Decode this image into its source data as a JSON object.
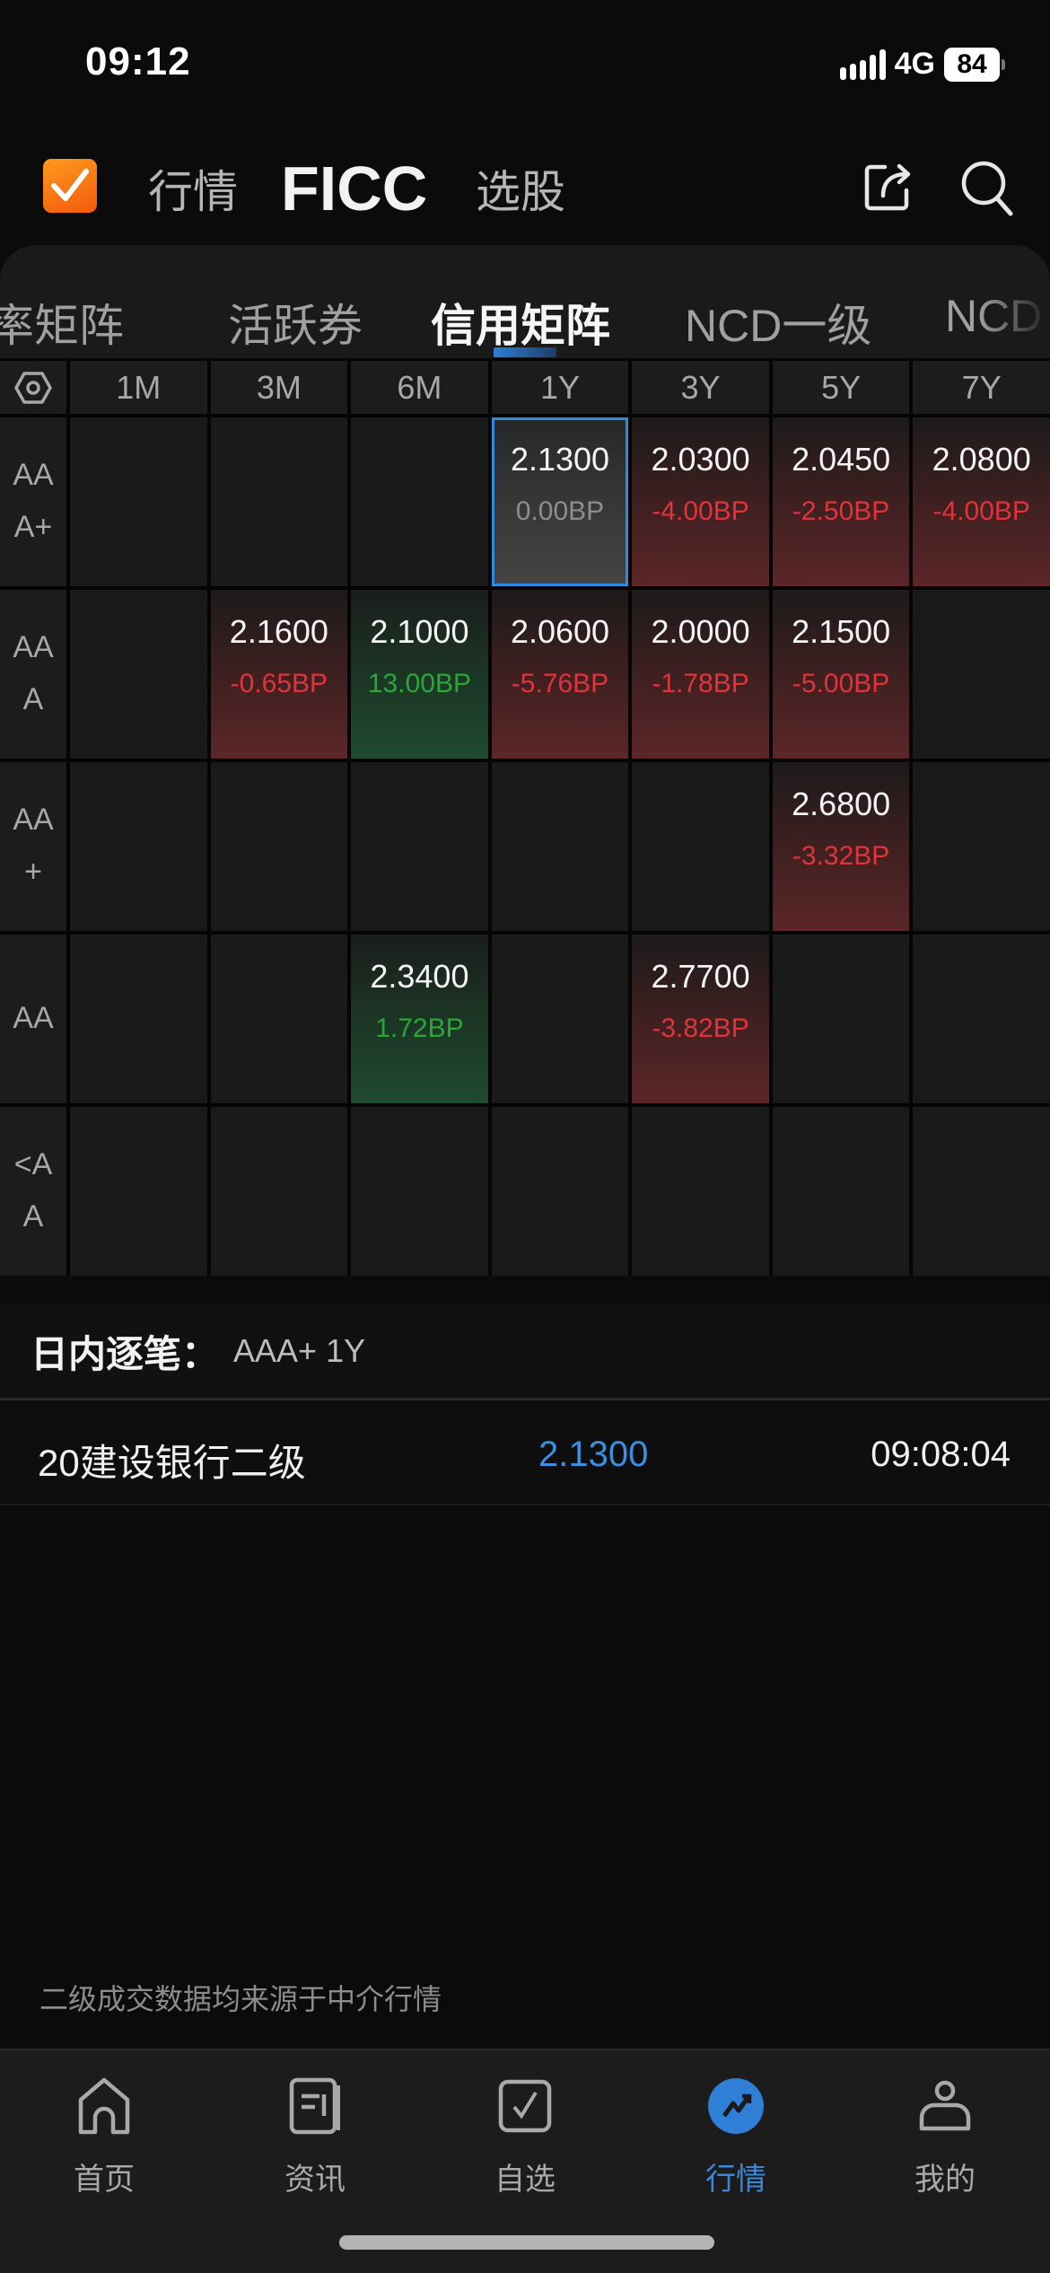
{
  "status_bar": {
    "time": "09:12",
    "network": "4G",
    "battery": "84",
    "icons": [
      "signal-icon",
      "battery-icon"
    ]
  },
  "app_header": {
    "logo": "app-logo-checkmark",
    "nav": [
      "行情",
      "FICC",
      "选股"
    ],
    "active_nav": "FICC",
    "actions": [
      "share-icon",
      "search-icon"
    ]
  },
  "sub_tabs": {
    "items": [
      "利率矩阵",
      "活跃券",
      "信用矩阵",
      "NCD一级",
      "NCD"
    ],
    "visible_labels": [
      "率矩阵",
      "活跃券",
      "信用矩阵",
      "NCD一级",
      "NCD"
    ],
    "active": "信用矩阵"
  },
  "matrix": {
    "settings_icon": "settings-hex-icon",
    "columns": [
      "1M",
      "3M",
      "6M",
      "1Y",
      "3Y",
      "5Y",
      "7Y"
    ],
    "rows": [
      {
        "label": "AAA+",
        "label_lines": [
          "AA",
          "A+"
        ],
        "cells": [
          null,
          null,
          null,
          {
            "rate": "2.1300",
            "change": "0.00BP",
            "trend": "flat",
            "selected": true
          },
          {
            "rate": "2.0300",
            "change": "-4.00BP",
            "trend": "down"
          },
          {
            "rate": "2.0450",
            "change": "-2.50BP",
            "trend": "down"
          },
          {
            "rate": "2.0800",
            "change": "-4.00BP",
            "trend": "down"
          }
        ]
      },
      {
        "label": "AAA",
        "label_lines": [
          "AA",
          "A"
        ],
        "cells": [
          null,
          {
            "rate": "2.1600",
            "change": "-0.65BP",
            "trend": "down"
          },
          {
            "rate": "2.1000",
            "change": "13.00BP",
            "trend": "up"
          },
          {
            "rate": "2.0600",
            "change": "-5.76BP",
            "trend": "down"
          },
          {
            "rate": "2.0000",
            "change": "-1.78BP",
            "trend": "down"
          },
          {
            "rate": "2.1500",
            "change": "-5.00BP",
            "trend": "down"
          },
          null
        ]
      },
      {
        "label": "AA+",
        "label_lines": [
          "AA",
          "+"
        ],
        "cells": [
          null,
          null,
          null,
          null,
          null,
          {
            "rate": "2.6800",
            "change": "-3.32BP",
            "trend": "down"
          },
          null
        ]
      },
      {
        "label": "AA",
        "label_lines": [
          "AA"
        ],
        "cells": [
          null,
          null,
          {
            "rate": "2.3400",
            "change": "1.72BP",
            "trend": "up"
          },
          null,
          {
            "rate": "2.7700",
            "change": "-3.82BP",
            "trend": "down"
          },
          null,
          null
        ]
      },
      {
        "label": "<AA",
        "label_lines": [
          "<A",
          "A"
        ],
        "cells": [
          null,
          null,
          null,
          null,
          null,
          null,
          null
        ]
      }
    ]
  },
  "intraday": {
    "title": "日内逐笔：",
    "selection": "AAA+ 1Y",
    "trades": [
      {
        "name": "20建设银行二级",
        "rate": "2.1300",
        "time": "09:08:04"
      }
    ]
  },
  "footnote": "二级成交数据均来源于中介行情",
  "bottom_nav": {
    "items": [
      {
        "label": "首页",
        "icon": "home-icon"
      },
      {
        "label": "资讯",
        "icon": "news-icon"
      },
      {
        "label": "自选",
        "icon": "watchlist-check-icon"
      },
      {
        "label": "行情",
        "icon": "market-trend-icon",
        "active": true
      },
      {
        "label": "我的",
        "icon": "profile-icon"
      }
    ]
  },
  "colors": {
    "accent": "#2f8ae0",
    "down": "#e0343a",
    "up": "#2aa63a",
    "flat": "#8e8e8e",
    "logo": "#f4700f"
  }
}
